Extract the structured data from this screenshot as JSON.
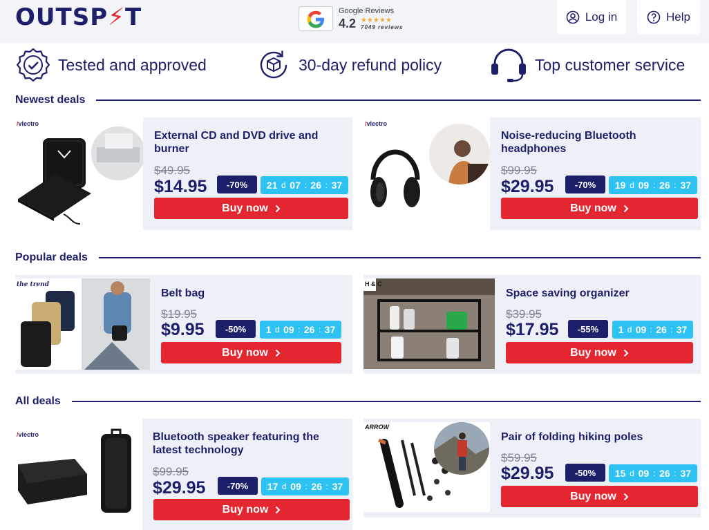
{
  "header": {
    "logo_text": "OUTSP",
    "logo_bolt": "⚡",
    "logo_tail": "T",
    "google": {
      "title": "Google Reviews",
      "score": "4.2",
      "stars": "★★★★★",
      "count": "7049 reviews"
    },
    "login_label": "Log in",
    "help_label": "Help"
  },
  "trust": [
    {
      "label": "Tested and approved",
      "icon": "badge-check-icon"
    },
    {
      "label": "30-day refund policy",
      "icon": "refund-box-icon"
    },
    {
      "label": "Top customer service",
      "icon": "headset-icon"
    }
  ],
  "sections": {
    "newest": "Newest deals",
    "popular": "Popular deals",
    "all": "All deals"
  },
  "deals": [
    {
      "title": "External CD and DVD drive and burner",
      "old_price": "$49.95",
      "price": "$14.95",
      "discount": "-70%",
      "timer": {
        "d": "21",
        "h": "07",
        "m": "26",
        "s": "37"
      },
      "buy": "Buy now",
      "brand": "vlectro"
    },
    {
      "title": "Noise-reducing Bluetooth headphones",
      "old_price": "$99.95",
      "price": "$29.95",
      "discount": "-70%",
      "timer": {
        "d": "19",
        "h": "09",
        "m": "26",
        "s": "37"
      },
      "buy": "Buy now",
      "brand": "vlectro"
    },
    {
      "title": "Belt bag",
      "old_price": "$19.95",
      "price": "$9.95",
      "discount": "-50%",
      "timer": {
        "d": "1",
        "h": "09",
        "m": "26",
        "s": "37"
      },
      "buy": "Buy now",
      "brand": "the trend"
    },
    {
      "title": "Space saving organizer",
      "old_price": "$39.95",
      "price": "$17.95",
      "discount": "-55%",
      "timer": {
        "d": "1",
        "h": "09",
        "m": "26",
        "s": "37"
      },
      "buy": "Buy now",
      "brand": "H & C"
    },
    {
      "title": "Bluetooth speaker featuring the latest technology",
      "old_price": "$99.95",
      "price": "$29.95",
      "discount": "-70%",
      "timer": {
        "d": "17",
        "h": "09",
        "m": "26",
        "s": "37"
      },
      "buy": "Buy now",
      "brand": "vlectro"
    },
    {
      "title": "Pair of folding hiking poles",
      "old_price": "$59.95",
      "price": "$29.95",
      "discount": "-50%",
      "timer": {
        "d": "15",
        "h": "09",
        "m": "26",
        "s": "37"
      },
      "buy": "Buy now",
      "brand": "ARROW"
    }
  ],
  "timer_units": {
    "d": "d",
    "sep": ":"
  },
  "colors": {
    "navy": "#1d1f6b",
    "red": "#e3262f",
    "cyan": "#2ec2f2",
    "card_bg": "#edf1f7",
    "header_bg": "#f2f4f8"
  }
}
